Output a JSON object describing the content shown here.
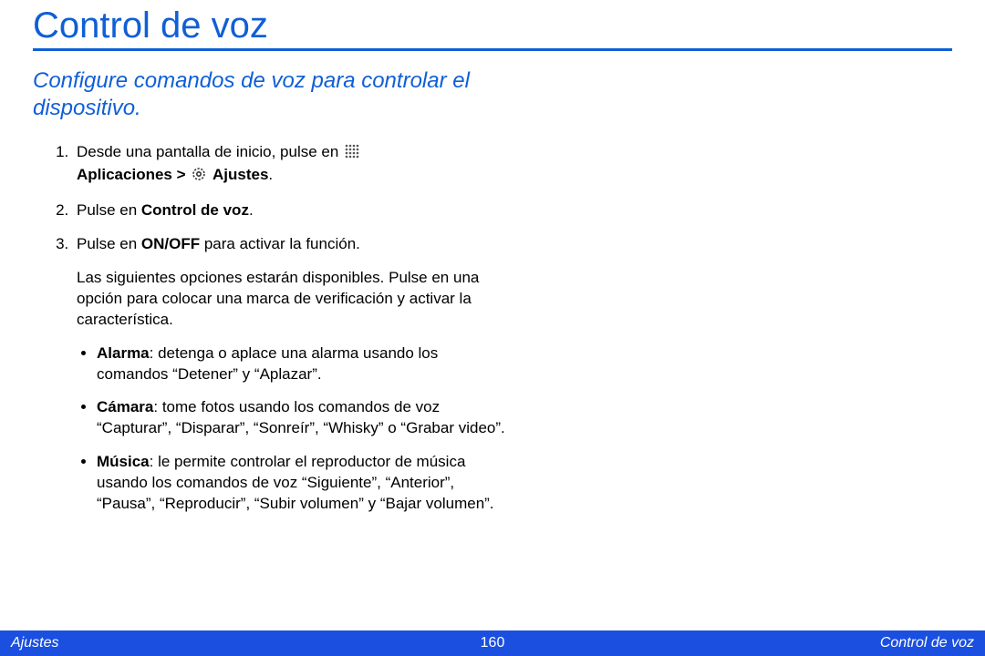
{
  "title": "Control de voz",
  "subtitle": "Configure comandos de voz para controlar el dispositivo.",
  "icons": {
    "apps": "apps-grid-icon",
    "settings": "settings-gear-icon"
  },
  "steps": [
    {
      "pre": "Desde una pantalla de inicio, pulse en ",
      "bold1": "Aplicaciones > ",
      "bold2": " Ajustes",
      "post": "."
    },
    {
      "pre": "Pulse en ",
      "bold1": "Control de voz",
      "post": "."
    },
    {
      "pre": "Pulse en ",
      "bold1": "ON/OFF",
      "post": " para activar la función.",
      "extra": "Las siguientes opciones estarán disponibles. Pulse en una opción para colocar una marca de verificación y activar la característica."
    }
  ],
  "bullets": [
    {
      "label": "Alarma",
      "text": ": detenga o aplace una alarma usando los comandos “Detener” y “Aplazar”."
    },
    {
      "label": "Cámara",
      "text": ": tome fotos usando los comandos de voz “Capturar”, “Disparar”, “Sonreír”, “Whisky” o “Grabar video”."
    },
    {
      "label": "Música",
      "text": ": le permite controlar el reproductor de música usando los comandos de voz “Siguiente”, “Anterior”, “Pausa”, “Reproducir”, “Subir volumen” y “Bajar volumen”."
    }
  ],
  "footer": {
    "left": "Ajustes",
    "center": "160",
    "right": "Control de voz"
  }
}
